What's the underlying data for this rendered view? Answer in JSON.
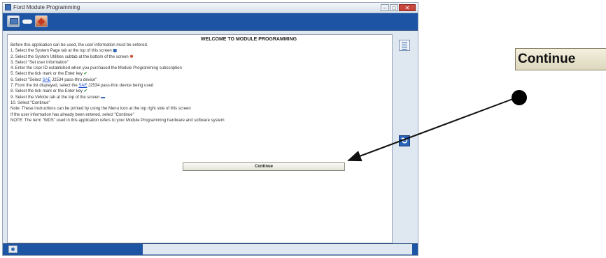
{
  "window": {
    "title": "Ford Module Programming",
    "buttons": {
      "minimize": "–",
      "maximize": "□",
      "close": "✕"
    }
  },
  "toolbar": {
    "tabs": [
      {
        "name": "system-page-tab",
        "icon": "system-page-icon"
      },
      {
        "name": "vehicle-tab",
        "icon": "vehicle-icon"
      },
      {
        "name": "system-utilities-tab",
        "icon": "utilities-icon"
      }
    ]
  },
  "content": {
    "heading": "WELCOME TO MODULE PROGRAMMING",
    "intro": "Before this application can be used, the user information must be entered.",
    "step1": "1. Select the System Page tab at the top of this screen",
    "step2": "2. Select the System Utilities subtab at the bottom of the screen",
    "step3": "3. Select \"Set user information\"",
    "step4": "4. Enter the User ID established when you purchased the Module Programming subscription",
    "step5": "5. Select the tick mark or the Enter key",
    "step6_pre": "6. Select \"Select ",
    "step6_link": "SAE",
    "step6_post": " J2534 pass-thru device\"",
    "step7_pre": "7. From the list displayed, select the ",
    "step7_link": "SAE",
    "step7_post": " J2534 pass-thru device being used",
    "step8": "8. Select the tick mark or the Enter key",
    "step9": "9. Select the Vehicle tab at the top of the screen",
    "step10": "10. Select \"Continue\"",
    "note1": "Note: These instructions can be printed by using the Menu icon at the top right side of this screen",
    "note2": "If the user information has already been entered, select \"Continue\"",
    "note3": "NOTE: The term \"WDS\" used in this application refers to your Module Programming hardware and software system",
    "continue_label": "Continue"
  },
  "glyphs": {
    "system_icon": "▣",
    "utilities_icon": "✱",
    "check": "✔",
    "vehicle": "▬"
  },
  "callout": {
    "label": "Continue"
  },
  "colors": {
    "toolbar_blue": "#1e54a4",
    "link_blue": "#1a4fd0",
    "check_green": "#2e8b2e"
  }
}
